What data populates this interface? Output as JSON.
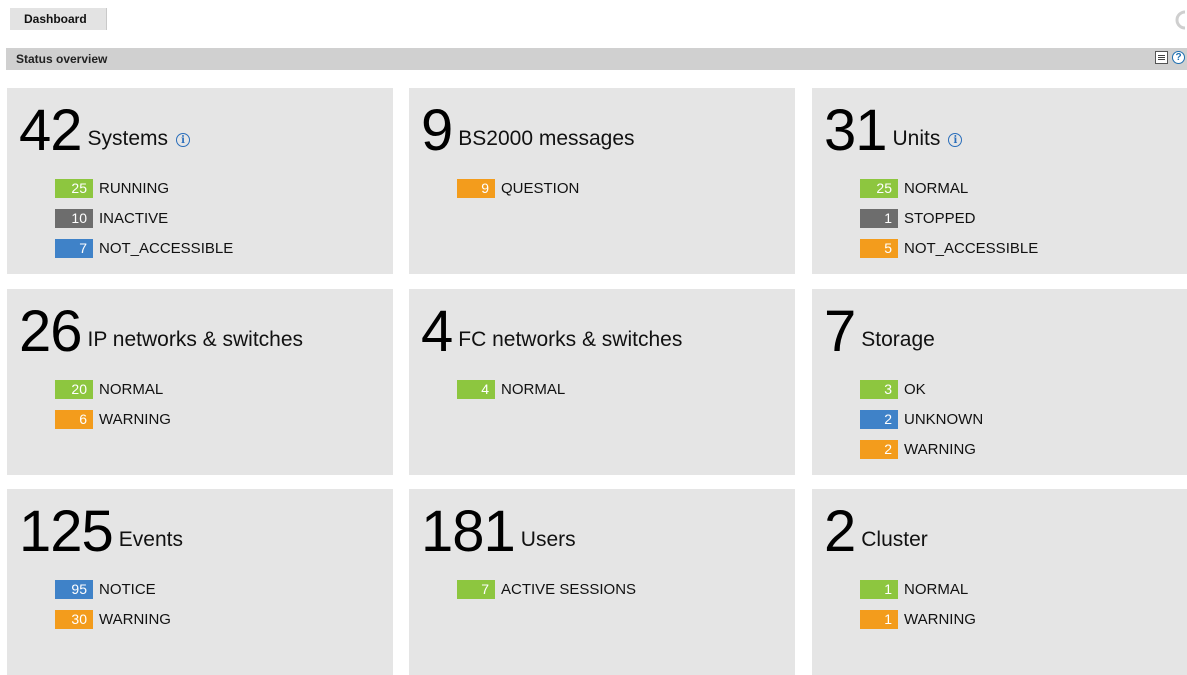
{
  "tab": {
    "label": "Dashboard"
  },
  "statusbar": {
    "title": "Status overview"
  },
  "colors": {
    "green": "#8dc63f",
    "orange": "#f39c1c",
    "gray": "#6d6d6d",
    "blue": "#3f82c8",
    "card_bg": "#e5e5e5"
  },
  "cards": [
    {
      "count": "42",
      "title": "Systems",
      "info": true,
      "rows": [
        {
          "value": "25",
          "label": "RUNNING",
          "color": "green"
        },
        {
          "value": "10",
          "label": "INACTIVE",
          "color": "gray"
        },
        {
          "value": "7",
          "label": "NOT_ACCESSIBLE",
          "color": "blue"
        }
      ]
    },
    {
      "count": "9",
      "title": "BS2000 messages",
      "info": false,
      "rows": [
        {
          "value": "9",
          "label": "QUESTION",
          "color": "orange"
        }
      ]
    },
    {
      "count": "31",
      "title": "Units",
      "info": true,
      "rows": [
        {
          "value": "25",
          "label": "NORMAL",
          "color": "green"
        },
        {
          "value": "1",
          "label": "STOPPED",
          "color": "gray"
        },
        {
          "value": "5",
          "label": "NOT_ACCESSIBLE",
          "color": "orange"
        }
      ]
    },
    {
      "count": "26",
      "title": "IP networks & switches",
      "info": false,
      "rows": [
        {
          "value": "20",
          "label": "NORMAL",
          "color": "green"
        },
        {
          "value": "6",
          "label": "WARNING",
          "color": "orange"
        }
      ]
    },
    {
      "count": "4",
      "title": "FC networks & switches",
      "info": false,
      "rows": [
        {
          "value": "4",
          "label": "NORMAL",
          "color": "green"
        }
      ]
    },
    {
      "count": "7",
      "title": "Storage",
      "info": false,
      "rows": [
        {
          "value": "3",
          "label": "OK",
          "color": "green"
        },
        {
          "value": "2",
          "label": "UNKNOWN",
          "color": "blue"
        },
        {
          "value": "2",
          "label": "WARNING",
          "color": "orange"
        }
      ]
    },
    {
      "count": "125",
      "title": "Events",
      "info": false,
      "rows": [
        {
          "value": "95",
          "label": "NOTICE",
          "color": "blue"
        },
        {
          "value": "30",
          "label": "WARNING",
          "color": "orange"
        }
      ]
    },
    {
      "count": "181",
      "title": "Users",
      "info": false,
      "rows": [
        {
          "value": "7",
          "label": "ACTIVE SESSIONS",
          "color": "green"
        }
      ]
    },
    {
      "count": "2",
      "title": "Cluster",
      "info": false,
      "rows": [
        {
          "value": "1",
          "label": "NORMAL",
          "color": "green"
        },
        {
          "value": "1",
          "label": "WARNING",
          "color": "orange"
        }
      ]
    }
  ]
}
